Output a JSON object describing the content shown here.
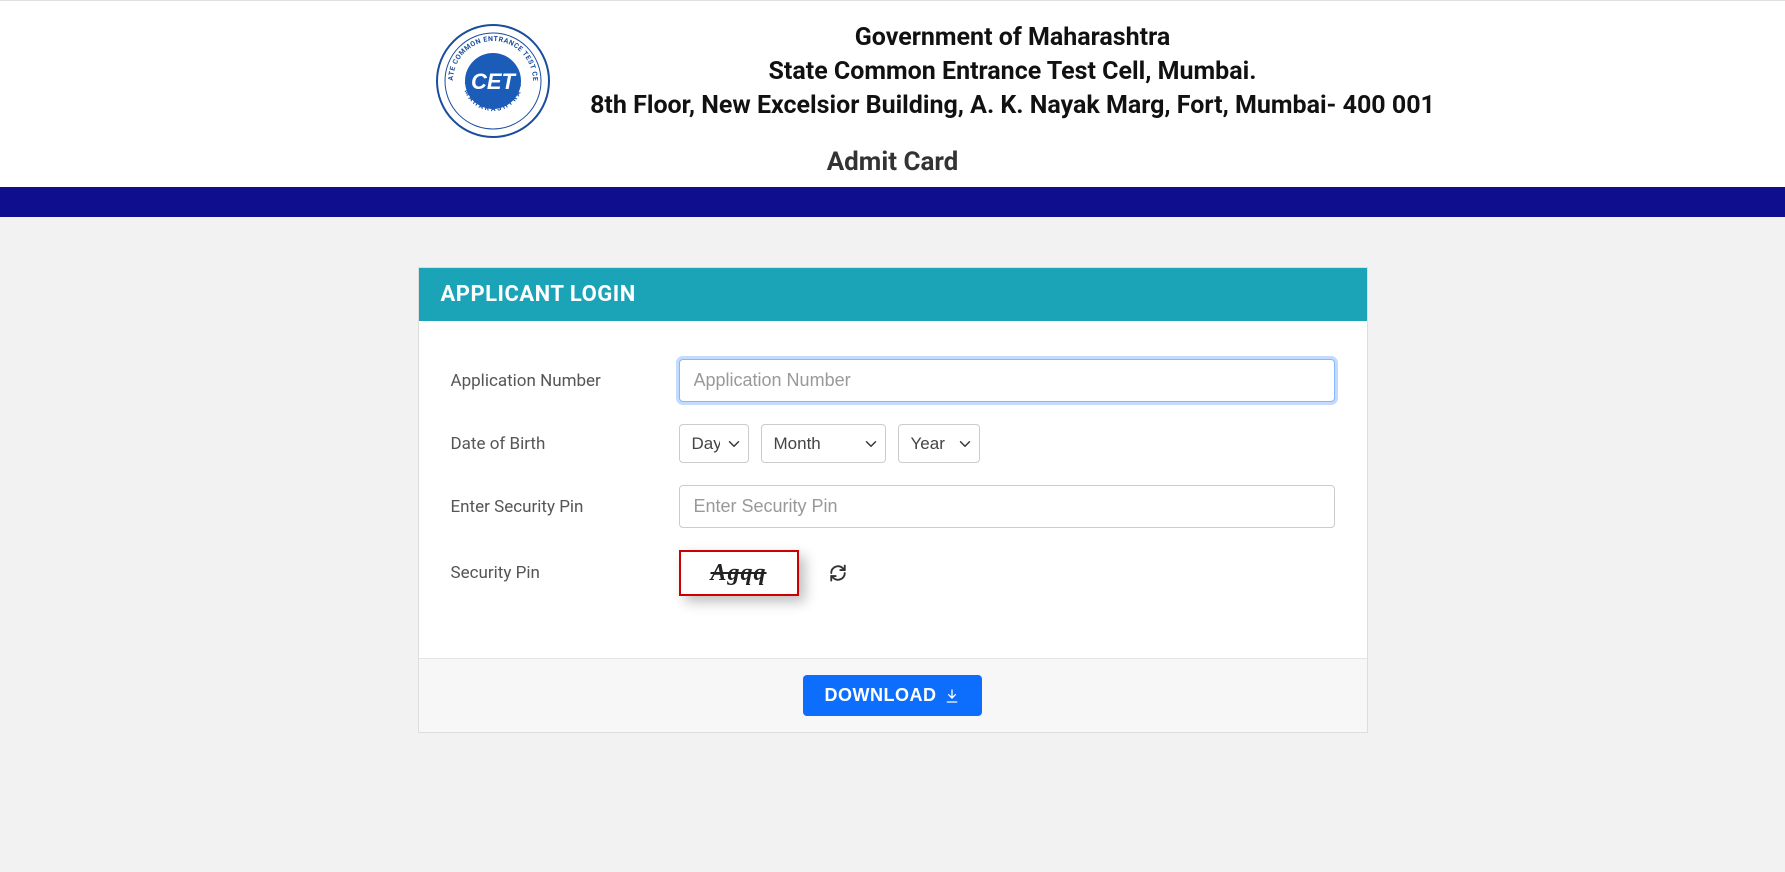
{
  "header": {
    "line1": "Government of Maharashtra",
    "line2": "State Common Entrance Test Cell, Mumbai.",
    "line3": "8th Floor, New Excelsior Building, A. K. Nayak Marg, Fort, Mumbai- 400 001",
    "admit_card": "Admit Card",
    "logo_text_top": "STATE COMMON ENTRANCE TEST CELL",
    "logo_text_center": "CET",
    "logo_text_bottom": "MAHARASHTRA"
  },
  "card": {
    "title": "APPLICANT LOGIN"
  },
  "form": {
    "app_num_label": "Application Number",
    "app_num_placeholder": "Application Number",
    "dob_label": "Date of Birth",
    "dob_day": "Day",
    "dob_month": "Month",
    "dob_year": "Year",
    "sec_pin_input_label": "Enter Security Pin",
    "sec_pin_input_placeholder": "Enter Security Pin",
    "sec_pin_label": "Security Pin",
    "captcha_value": "Agqq"
  },
  "footer": {
    "download_label": "DOWNLOAD"
  }
}
